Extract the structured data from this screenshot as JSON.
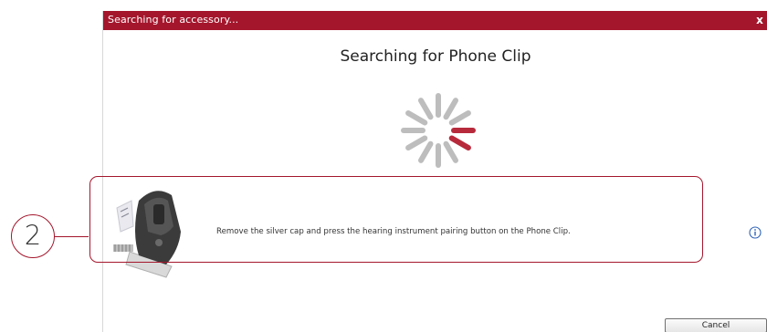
{
  "window": {
    "title": "Searching for accessory...",
    "close_label": "x"
  },
  "main": {
    "heading": "Searching for Phone Clip",
    "spinner_icon": "loading-spinner-icon",
    "instruction": "Remove the silver cap and press the hearing instrument pairing button on the Phone Clip.",
    "info_icon": "info-icon",
    "device_image": "phone-clip-device"
  },
  "footer": {
    "cancel_label": "Cancel"
  },
  "callout": {
    "number": "2"
  },
  "colors": {
    "accent": "#a4162c",
    "spinner_active": "#b72a3c",
    "spinner_inactive": "#bdbdbd",
    "info_blue": "#2f63b8"
  }
}
